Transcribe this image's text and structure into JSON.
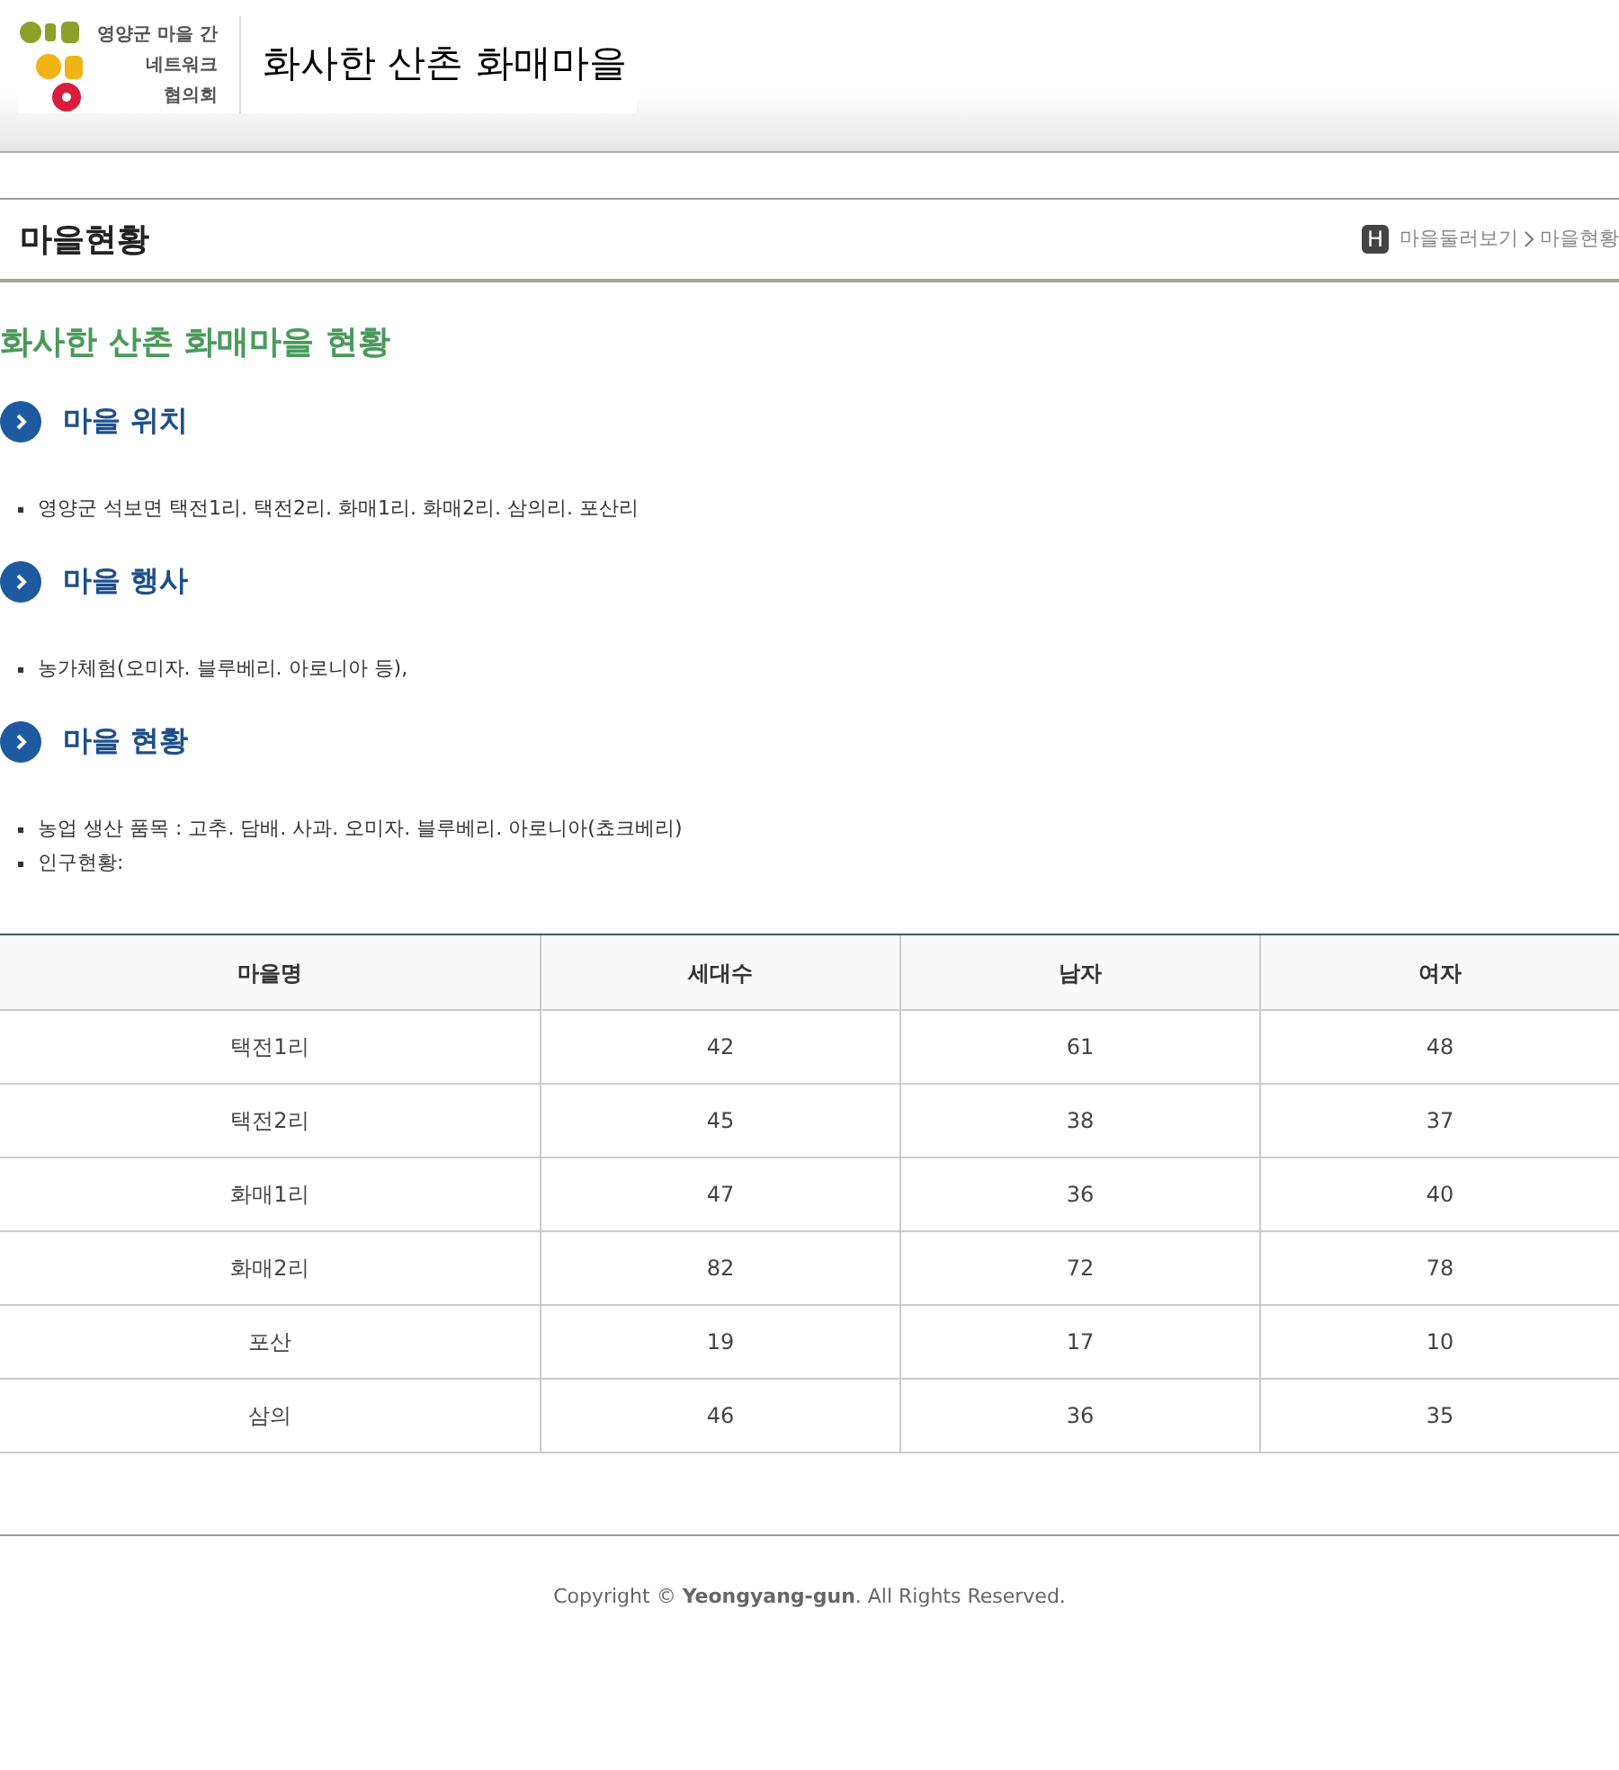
{
  "header": {
    "logo_lines": [
      "영양군 마을 간",
      "네트워크",
      "협의회"
    ],
    "site_title": "화사한 산촌 화매마을"
  },
  "page_bar": {
    "title": "마을현황",
    "home_badge": "H",
    "breadcrumb": [
      "마을둘러보기",
      "마을현황"
    ]
  },
  "content_title": "화사한 산촌 화매마을 현황",
  "sections": [
    {
      "heading": "마을 위치",
      "items": [
        "영양군 석보면 택전1리. 택전2리. 화매1리. 화매2리. 삼의리. 포산리"
      ]
    },
    {
      "heading": "마을 행사",
      "items": [
        "농가체험(오미자. 블루베리. 아로니아 등),"
      ]
    },
    {
      "heading": "마을 현황",
      "items": [
        "농업 생산 품목 : 고추. 담배. 사과. 오미자. 블루베리. 아로니아(쵸크베리)",
        "인구현황:"
      ]
    }
  ],
  "table": {
    "columns": [
      "마을명",
      "세대수",
      "남자",
      "여자"
    ],
    "rows": [
      [
        "택전1리",
        "42",
        "61",
        "48"
      ],
      [
        "택전2리",
        "45",
        "38",
        "37"
      ],
      [
        "화매1리",
        "47",
        "36",
        "40"
      ],
      [
        "화매2리",
        "82",
        "72",
        "78"
      ],
      [
        "포산",
        "19",
        "17",
        "10"
      ],
      [
        "삼의",
        "46",
        "36",
        "35"
      ]
    ]
  },
  "footer": "Copyright © **Yeongyang-gun**. All Rights Reserved."
}
